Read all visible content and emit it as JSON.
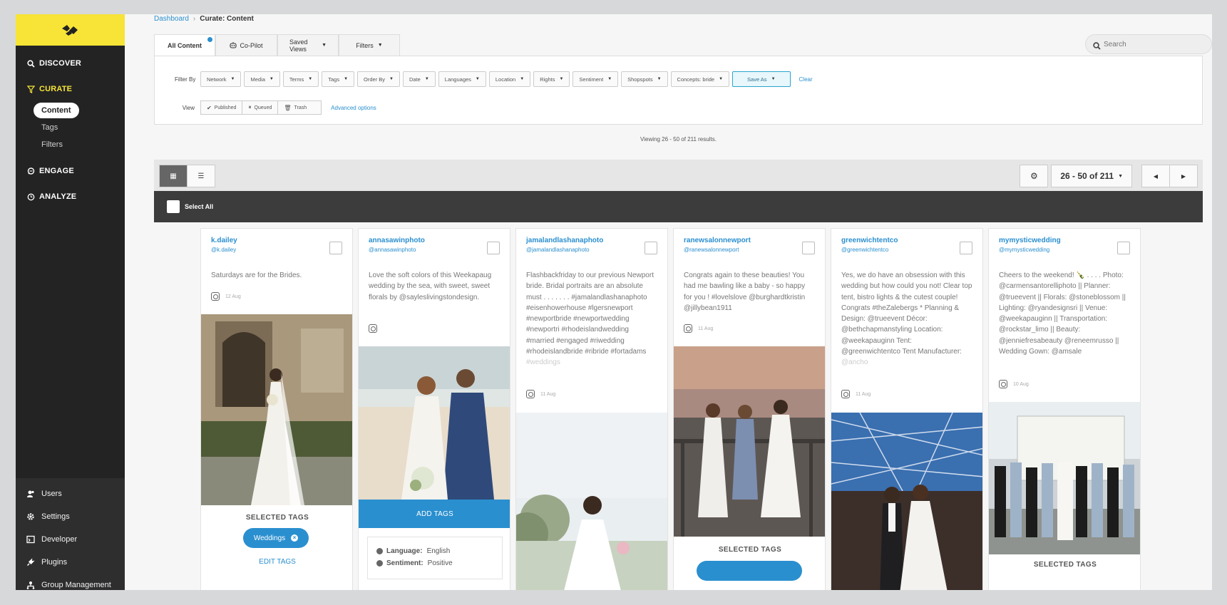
{
  "sidebar": {
    "nav": [
      {
        "label": "DISCOVER",
        "icon": "search-icon"
      },
      {
        "label": "CURATE",
        "icon": "funnel-icon"
      },
      {
        "label": "ENGAGE",
        "icon": "chat-icon"
      },
      {
        "label": "ANALYZE",
        "icon": "clock-icon"
      }
    ],
    "curate_sub": [
      "Content",
      "Tags",
      "Filters"
    ],
    "bottom": [
      {
        "label": "Users",
        "icon": "users-icon"
      },
      {
        "label": "Settings",
        "icon": "gear-icon"
      },
      {
        "label": "Developer",
        "icon": "code-icon"
      },
      {
        "label": "Plugins",
        "icon": "plug-icon"
      },
      {
        "label": "Group Management",
        "icon": "group-icon"
      }
    ]
  },
  "breadcrumb": {
    "home": "Dashboard",
    "sep": "›",
    "current": "Curate: Content"
  },
  "tabs": [
    {
      "label": "All Content"
    },
    {
      "label": "Co-Pilot"
    },
    {
      "label": "Saved Views"
    },
    {
      "label": "Filters"
    }
  ],
  "search": {
    "placeholder": "Search"
  },
  "filters": {
    "filter_by_label": "Filter By",
    "buttons": [
      "Network",
      "Media",
      "Terms",
      "Tags",
      "Order By",
      "Date",
      "Languages",
      "Location",
      "Rights",
      "Sentiment",
      "Shopspots",
      "Concepts: bride"
    ],
    "save_as": "Save As",
    "clear": "Clear",
    "view_label": "View",
    "view_buttons": [
      "Published",
      "Queued",
      "Trash"
    ],
    "advanced": "Advanced options"
  },
  "viewing": "Viewing 26 - 50 of 211 results.",
  "pager": {
    "range": "26 - 50 of 211"
  },
  "select_all": "Select All",
  "cards": [
    {
      "name": "k.dailey",
      "handle": "@k.dailey",
      "text": "Saturdays are for the Brides.",
      "date": "12 Aug",
      "selected_tags_label": "SELECTED TAGS",
      "tag": "Weddings",
      "edit": "EDIT TAGS"
    },
    {
      "name": "annasawinphoto",
      "handle": "@annasawinphoto",
      "text": "Love the soft colors of this Weekapaug wedding by the sea, with sweet, sweet florals by @sayleslivingstondesign.",
      "date": "",
      "add_tags": "ADD TAGS",
      "info": {
        "language_label": "Language:",
        "language": "English",
        "sentiment_label": "Sentiment:",
        "sentiment": "Positive"
      }
    },
    {
      "name": "jamalandlashanaphoto",
      "handle": "@jamalandlashanaphoto",
      "text": "Flashbackfriday to our previous Newport bride. Bridal portraits are an absolute must . . . . . . . #jamalandlashanaphoto #eisenhowerhouse #lgersnewport #newportbride #newportwedding #newportri #rhodeislandwedding #married #engaged #riwedding #rhodeislandbride #ribride #fortadams",
      "text_fade": "#weddings",
      "date": "11 Aug"
    },
    {
      "name": "ranewsalonnewport",
      "handle": "@ranewsalonnewport",
      "text": "Congrats again to these beauties! You had me bawling like a baby - so happy for you ! #lovelslove @burghardtkristin @jillybean1911",
      "date": "11 Aug",
      "selected_tags_label": "SELECTED TAGS"
    },
    {
      "name": "greenwichtentco",
      "handle": "@greenwichtentco",
      "text": "Yes, we do have an obsession with this wedding but how could you not! Clear top tent, bistro lights & the cutest couple! Congrats #theZalebergs * Planning & Design: @trueevent Décor: @bethchapmanstyling Location: @weekapauginn Tent: @greenwichtentco Tent Manufacturer:",
      "text_fade": "@ancho",
      "date": "11 Aug"
    },
    {
      "name": "mymysticwedding",
      "handle": "@mymysticwedding",
      "text": "Cheers to the weekend! 🍾 . . . . Photo: @carmensantorelliphoto || Planner: @trueevent || Florals: @stoneblossom || Lighting: @ryandesignsri || Venue: @weekapauginn || Transportation: @rockstar_limo || Beauty: @jenniefresabeauty @reneemrusso || Wedding Gown: @amsale",
      "date": "10 Aug",
      "selected_tags_label": "SELECTED TAGS"
    }
  ],
  "colors": {
    "accent": "#2a8fcf",
    "brand": "#f7e437",
    "sidebar": "#232323"
  }
}
